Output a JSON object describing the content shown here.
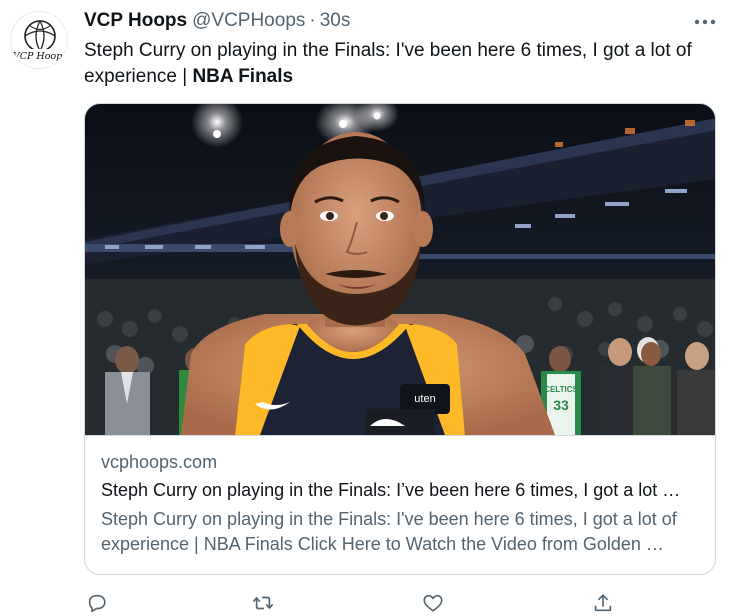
{
  "author": {
    "name": "VCP Hoops",
    "handle": "@VCPHoops",
    "separator": "·",
    "time": "30s",
    "avatar_text": "VCP Hoops"
  },
  "tweet": {
    "text": "Steph Curry on playing in the Finals: I've been here 6 times, I got a lot of experience | ",
    "text_bold": "NBA Finals"
  },
  "card": {
    "domain": "vcphoops.com",
    "title": "Steph Curry on playing in the Finals: I’ve been here 6 times, I got a lot …",
    "description": "Steph Curry on playing in the Finals: I've been here 6 times, I got a lot of experience | NBA Finals Click Here to Watch the Video from Golden …",
    "image_overlay": {
      "mic_text": "uten",
      "jersey_text": "CELTICS",
      "jersey_number": "33"
    }
  },
  "icons": {
    "more": "more-horizontal-icon",
    "reply": "reply-icon",
    "retweet": "retweet-icon",
    "like": "heart-icon",
    "share": "share-icon"
  },
  "colors": {
    "text_primary": "#0f1419",
    "text_secondary": "#536471",
    "border": "#cfd9de",
    "jersey_navy": "#1d2335",
    "jersey_gold": "#fdb927",
    "celtics_green": "#2a8a4a"
  }
}
